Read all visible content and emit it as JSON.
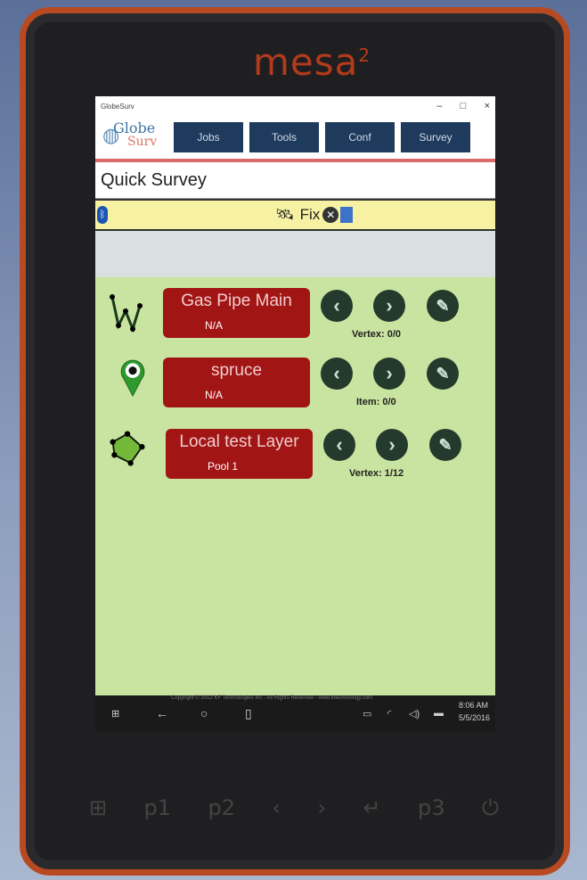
{
  "device": {
    "brand": "mesa",
    "brand_sup": "2"
  },
  "window": {
    "title": "GlobeSurv",
    "controls": [
      "–",
      "□",
      "×"
    ]
  },
  "logo": {
    "line1": "Globe",
    "line2": "Surv"
  },
  "nav": [
    "Jobs",
    "Tools",
    "Conf",
    "Survey"
  ],
  "page": {
    "title": "Quick Survey"
  },
  "status": {
    "fix_label": "Fix",
    "bluetooth": "ᛒ",
    "x_mark": "✕"
  },
  "layers": [
    {
      "name": "Gas Pipe Main",
      "sub": "N/A",
      "counter": "Vertex: 0/0",
      "icon": "polyline-icon"
    },
    {
      "name": "spruce",
      "sub": "N/A",
      "counter": "Item: 0/0",
      "icon": "map-pin-icon"
    },
    {
      "name": "Local test Layer",
      "sub": "Pool 1",
      "counter": "Vertex: 1/12",
      "icon": "polygon-icon"
    }
  ],
  "buttons": {
    "prev": "‹",
    "next": "›",
    "edit": "✎"
  },
  "taskbar": {
    "time": "8:06 AM",
    "date": "5/5/2016",
    "copyright": "Copyright © 2012 KF Technologies Inc - All Rights Reserved - www.kftechnology.com"
  },
  "hardware_keys": [
    "⊞",
    "p1",
    "p2",
    "‹",
    "›",
    "↵",
    "p3",
    "⏻"
  ],
  "colors": {
    "bezel": "#1f1f21",
    "bezel_trim": "#b84a22",
    "nav_button": "#1e3b5d",
    "layer_button": "#a11515",
    "panel_bg": "#c9e3a0",
    "status_bg": "#f7f1a3"
  }
}
